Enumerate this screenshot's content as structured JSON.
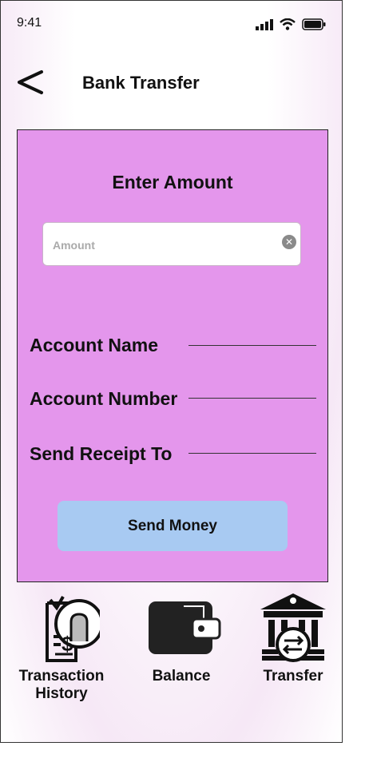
{
  "status_bar": {
    "time": "9:41"
  },
  "header": {
    "title": "Bank Transfer"
  },
  "card": {
    "heading": "Enter Amount",
    "amount_placeholder": "Amount",
    "amount_value": "",
    "fields": [
      {
        "label": "Account Name",
        "value": ""
      },
      {
        "label": "Account Number",
        "value": ""
      },
      {
        "label": "Send Receipt To",
        "value": ""
      }
    ],
    "send_button": "Send Money",
    "background_color": "#e496ec",
    "button_color": "#a8caf2"
  },
  "bottom_nav": [
    {
      "label": "Transaction History",
      "icon": "receipt-dollar-icon"
    },
    {
      "label": "Balance",
      "icon": "wallet-icon"
    },
    {
      "label": "Transfer",
      "icon": "bank-transfer-icon"
    }
  ]
}
